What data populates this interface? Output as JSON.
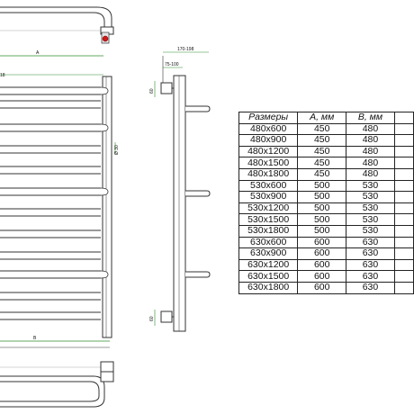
{
  "dimensions": {
    "a": "A",
    "b": "B",
    "d18": "18",
    "g30": "Ø 30",
    "w170_198": "170-198",
    "w75_100": "75-100",
    "h60": "60"
  },
  "colors": {
    "line": "#222222",
    "green": "#2e8b2e",
    "red": "#d01818"
  },
  "table": {
    "headers": [
      "Размеры",
      "A, мм",
      "B, мм"
    ],
    "rows": [
      [
        "480x600",
        "450",
        "480"
      ],
      [
        "480x900",
        "450",
        "480"
      ],
      [
        "480x1200",
        "450",
        "480"
      ],
      [
        "480x1500",
        "450",
        "480"
      ],
      [
        "480x1800",
        "450",
        "480"
      ],
      [
        "530x600",
        "500",
        "530"
      ],
      [
        "530x900",
        "500",
        "530"
      ],
      [
        "530x1200",
        "500",
        "530"
      ],
      [
        "530x1500",
        "500",
        "530"
      ],
      [
        "530x1800",
        "500",
        "530"
      ],
      [
        "630x600",
        "600",
        "630"
      ],
      [
        "630x900",
        "600",
        "630"
      ],
      [
        "630x1200",
        "600",
        "630"
      ],
      [
        "630x1500",
        "600",
        "630"
      ],
      [
        "630x1800",
        "600",
        "630"
      ]
    ]
  }
}
